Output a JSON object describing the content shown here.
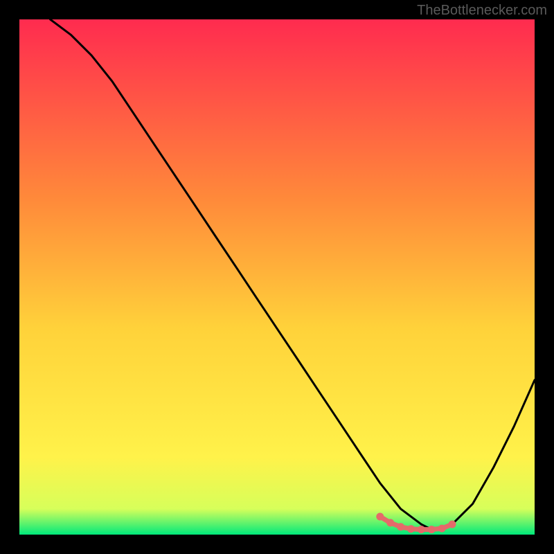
{
  "watermark": "TheBottlenecker.com",
  "chart_data": {
    "type": "line",
    "title": "",
    "xlabel": "",
    "ylabel": "",
    "xlim": [
      0,
      100
    ],
    "ylim": [
      0,
      100
    ],
    "grid": false,
    "background_gradient": {
      "top": "#ff2b4f",
      "mid_upper": "#ff8a3a",
      "mid": "#ffd23a",
      "mid_lower": "#fff24a",
      "bottom": "#00e97b"
    },
    "series": [
      {
        "name": "curve",
        "color": "#000000",
        "x": [
          6,
          10,
          14,
          18,
          22,
          26,
          30,
          34,
          38,
          42,
          46,
          50,
          54,
          58,
          62,
          66,
          70,
          74,
          78,
          80,
          82,
          84,
          88,
          92,
          96,
          100
        ],
        "y": [
          100,
          97,
          93,
          88,
          82,
          76,
          70,
          64,
          58,
          52,
          46,
          40,
          34,
          28,
          22,
          16,
          10,
          5,
          2,
          1,
          1,
          2,
          6,
          13,
          21,
          30
        ]
      },
      {
        "name": "highlight",
        "color": "#e46a6a",
        "x": [
          70,
          72,
          74,
          76,
          78,
          80,
          82,
          84
        ],
        "y": [
          3.5,
          2.3,
          1.5,
          1.1,
          1.0,
          1.0,
          1.2,
          2.0
        ]
      }
    ],
    "highlight_markers": {
      "color": "#e46a6a",
      "points": [
        {
          "x": 70,
          "y": 3.5
        },
        {
          "x": 72,
          "y": 2.3
        },
        {
          "x": 74,
          "y": 1.5
        },
        {
          "x": 76,
          "y": 1.1
        },
        {
          "x": 78,
          "y": 1.0
        },
        {
          "x": 80,
          "y": 1.0
        },
        {
          "x": 82,
          "y": 1.2
        },
        {
          "x": 84,
          "y": 2.0
        }
      ]
    }
  }
}
